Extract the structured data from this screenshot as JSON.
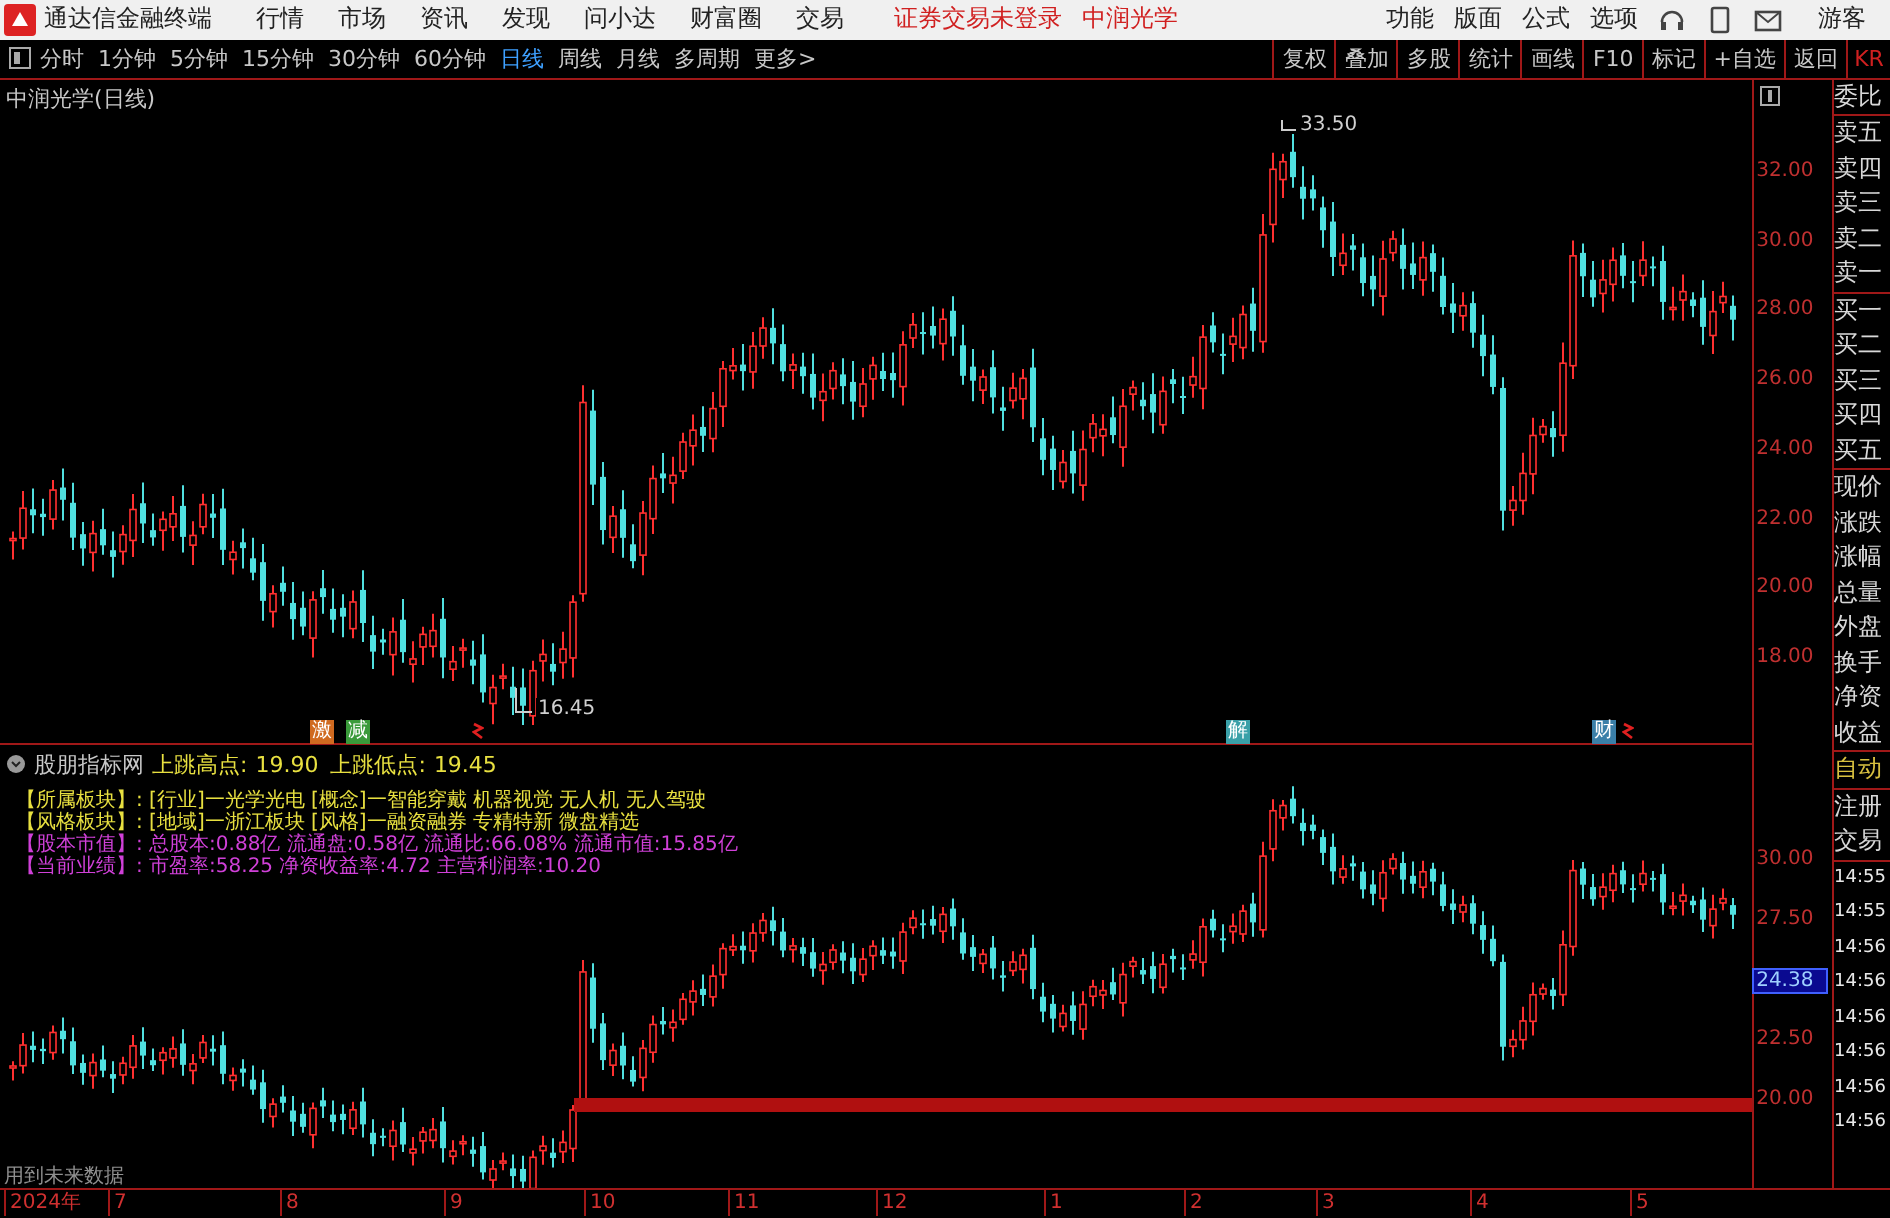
{
  "menu_bar": {
    "app_title": "通达信金融终端",
    "items": [
      "行情",
      "市场",
      "资讯",
      "发现",
      "问小达",
      "财富圈",
      "交易"
    ],
    "login_status": "证券交易未登录",
    "stock_name": "中润光学",
    "right_items": [
      "功能",
      "版面",
      "公式",
      "选项"
    ],
    "user": "游客"
  },
  "toolbar": {
    "periods": [
      {
        "label": "分时",
        "selected": false
      },
      {
        "label": "1分钟",
        "selected": false
      },
      {
        "label": "5分钟",
        "selected": false
      },
      {
        "label": "15分钟",
        "selected": false
      },
      {
        "label": "30分钟",
        "selected": false
      },
      {
        "label": "60分钟",
        "selected": false
      },
      {
        "label": "日线",
        "selected": true
      },
      {
        "label": "周线",
        "selected": false
      },
      {
        "label": "月线",
        "selected": false
      },
      {
        "label": "多周期",
        "selected": false
      },
      {
        "label": "更多>",
        "selected": false
      }
    ],
    "actions": [
      "复权",
      "叠加",
      "多股",
      "统计",
      "画线",
      "F10",
      "标记",
      "+自选",
      "返回",
      "KR"
    ]
  },
  "price_chart": {
    "title": "中润光学(日线)",
    "y_axis": [
      "32.00",
      "30.00",
      "28.00",
      "26.00",
      "24.00",
      "22.00",
      "20.00",
      "18.00"
    ],
    "high_label": "33.50",
    "low_label": "16.45",
    "markers": [
      {
        "kind": "tag",
        "label": "激",
        "color": "#d06a20"
      },
      {
        "kind": "tag",
        "label": "减",
        "color": "#3a9a3a"
      },
      {
        "kind": "flag",
        "color": "#e02020"
      },
      {
        "kind": "tag",
        "label": "解",
        "color": "#3aa0a8"
      },
      {
        "kind": "tag",
        "label": "财",
        "color": "#3a7fa8"
      },
      {
        "kind": "flag",
        "color": "#e02020"
      }
    ]
  },
  "indicator_panel": {
    "name": "股朋指标网",
    "readings": [
      {
        "label": "上跳高点:",
        "value": "19.90"
      },
      {
        "label": "上跳低点:",
        "value": "19.45"
      }
    ],
    "info_lines": [
      {
        "text": "【所属板块】: [行业]一光学光电 [概念]一智能穿戴 机器视觉 无人机 无人驾驶",
        "color": "#e8e040"
      },
      {
        "text": "【风格板块】: [地域]一浙江板块 [风格]一融资融券 专精特新 微盘精选",
        "color": "#e8e040"
      },
      {
        "text": "【股本市值】: 总股本:0.88亿 流通盘:0.58亿 流通比:66.08% 流通市值:15.85亿",
        "color": "#d040d8"
      },
      {
        "text": "【当前业绩】: 市盈率:58.25 净资收益率:4.72 主营利润率:10.20",
        "color": "#d040d8"
      }
    ],
    "y_axis": [
      "30.00",
      "27.50",
      "22.50",
      "20.00"
    ],
    "current_value": "24.38",
    "note": "用到未来数据"
  },
  "time_axis": [
    "2024年",
    "7",
    "8",
    "9",
    "10",
    "11",
    "12",
    "1",
    "2",
    "3",
    "4",
    "5"
  ],
  "quote_panel": {
    "groups": [
      {
        "labels": [
          "委比"
        ],
        "highlighted": false
      },
      {
        "labels": [
          "卖五",
          "卖四",
          "卖三",
          "卖二",
          "卖一"
        ],
        "highlighted": false
      },
      {
        "labels": [
          "买一",
          "买二",
          "买三",
          "买四",
          "买五"
        ],
        "highlighted": false
      },
      {
        "labels": [
          "现价",
          "涨跌",
          "涨幅",
          "总量",
          "外盘",
          "换手",
          "净资",
          "收益"
        ],
        "highlighted": false
      },
      {
        "labels": [
          "自动"
        ],
        "highlighted": true
      },
      {
        "labels": [
          "注册",
          "交易"
        ],
        "highlighted": false
      }
    ],
    "times": [
      "14:55",
      "14:55",
      "14:56",
      "14:56",
      "14:56",
      "14:56",
      "14:56",
      "14:56"
    ]
  }
}
